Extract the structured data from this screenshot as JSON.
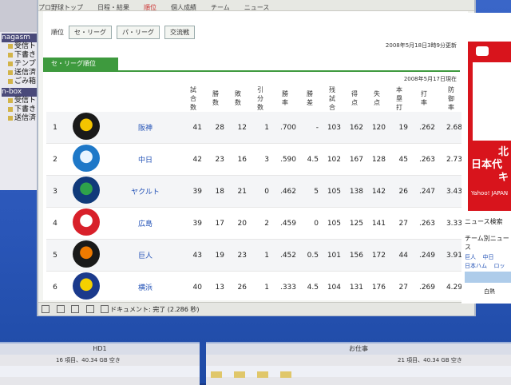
{
  "nav": {
    "items": [
      "プロ野球トップ",
      "日程・結果",
      "順位",
      "個人成績",
      "チーム",
      "ニュース"
    ],
    "active_index": 2
  },
  "tabs": {
    "label": "順位",
    "items": [
      "セ・リーグ",
      "パ・リーグ",
      "交流戦"
    ]
  },
  "updated": "2008年5月18日3時9分更新",
  "section_title": "セ・リーグ順位",
  "as_of": "2008年5月17日現在",
  "columns": [
    "試合数",
    "勝数",
    "敗数",
    "引分数",
    "勝率",
    "勝差",
    "残試合",
    "得点",
    "失点",
    "本塁打",
    "打率",
    "防御率"
  ],
  "standings": [
    {
      "rank": "1",
      "team": "阪神",
      "logo": "tigers",
      "color": "#1a1a1a",
      "accent": "#f4c400",
      "stats": [
        "41",
        "28",
        "12",
        "1",
        ".700",
        "-",
        "103",
        "162",
        "120",
        "19",
        ".262",
        "2.68"
      ]
    },
    {
      "rank": "2",
      "team": "中日",
      "logo": "dragons",
      "color": "#1e78c8",
      "accent": "#e8f4ff",
      "stats": [
        "42",
        "23",
        "16",
        "3",
        ".590",
        "4.5",
        "102",
        "167",
        "128",
        "45",
        ".263",
        "2.73"
      ]
    },
    {
      "rank": "3",
      "team": "ヤクルト",
      "logo": "swallows",
      "color": "#103a7a",
      "accent": "#2ea24a",
      "stats": [
        "39",
        "18",
        "21",
        "0",
        ".462",
        "5",
        "105",
        "138",
        "142",
        "26",
        ".247",
        "3.43"
      ]
    },
    {
      "rank": "4",
      "team": "広島",
      "logo": "carp",
      "color": "#d8202a",
      "accent": "#ffffff",
      "stats": [
        "39",
        "17",
        "20",
        "2",
        ".459",
        "0",
        "105",
        "125",
        "141",
        "27",
        ".263",
        "3.33"
      ]
    },
    {
      "rank": "5",
      "team": "巨人",
      "logo": "giants",
      "color": "#1a1a1a",
      "accent": "#f07a00",
      "stats": [
        "43",
        "19",
        "23",
        "1",
        ".452",
        "0.5",
        "101",
        "156",
        "172",
        "44",
        ".249",
        "3.91"
      ]
    },
    {
      "rank": "6",
      "team": "横浜",
      "logo": "baystars",
      "color": "#1b3a8c",
      "accent": "#f4d000",
      "stats": [
        "40",
        "13",
        "26",
        "1",
        ".333",
        "4.5",
        "104",
        "131",
        "176",
        "27",
        ".269",
        "4.29"
      ]
    }
  ],
  "status": {
    "text": "ドキュメント: 完了 (2.286 秒)"
  },
  "ad": {
    "line1": "北",
    "line2": "日本代",
    "line3": "キ",
    "brand": "Yahoo! JAPAN"
  },
  "sidebar_news": {
    "title": "ニュース検索",
    "team_label": "チーム別ニュース",
    "links": [
      "巨人",
      "中日",
      "日本ハム",
      "ロッテ"
    ],
    "bottom": "白熱"
  },
  "mail": {
    "groups": [
      {
        "name": "nagasm",
        "folders": [
          "受信ト",
          "下書き",
          "テンプ",
          "送信済",
          "ごみ箱"
        ]
      },
      {
        "name": "n-box",
        "folders": [
          "受信ト",
          "下書き",
          "送信済"
        ]
      }
    ]
  },
  "desktop": {
    "left": {
      "title": "HD1",
      "info": "16 項目、40.34 GB 空き"
    },
    "right": {
      "title": "お仕事",
      "info": "21 項目、40.34 GB 空き"
    }
  },
  "colors": {
    "accent_green": "#3e9a3e",
    "link_blue": "#1f4fb5",
    "ad_red": "#d8141c"
  }
}
